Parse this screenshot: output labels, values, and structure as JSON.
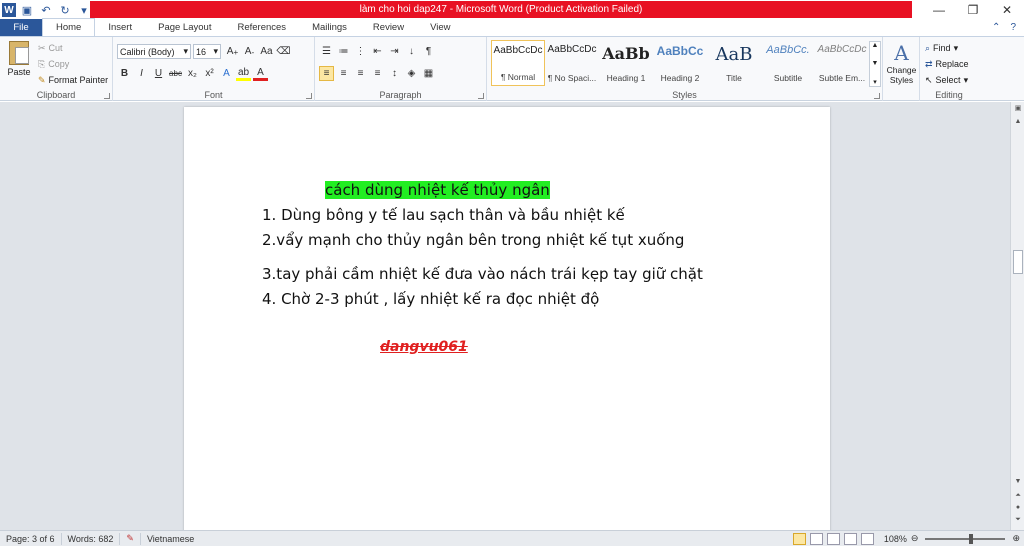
{
  "titlebar": {
    "title": "làm cho hoi dap247  -  Microsoft Word (Product Activation Failed)"
  },
  "tabs": [
    "File",
    "Home",
    "Insert",
    "Page Layout",
    "References",
    "Mailings",
    "Review",
    "View"
  ],
  "clipboard": {
    "paste": "Paste",
    "cut": "Cut",
    "copy": "Copy",
    "format_painter": "Format Painter",
    "label": "Clipboard"
  },
  "font": {
    "name": "Calibri (Body)",
    "size": "16",
    "label": "Font"
  },
  "paragraph": {
    "label": "Paragraph"
  },
  "styles": {
    "label": "Styles",
    "items": [
      {
        "sample": "AaBbCcDc",
        "name": "¶ Normal"
      },
      {
        "sample": "AaBbCcDc",
        "name": "¶ No Spaci..."
      },
      {
        "sample": "AaBb",
        "name": "Heading 1"
      },
      {
        "sample": "AaBbCc",
        "name": "Heading 2"
      },
      {
        "sample": "AaB",
        "name": "Title"
      },
      {
        "sample": "AaBbCc.",
        "name": "Subtitle"
      },
      {
        "sample": "AaBbCcDc",
        "name": "Subtle Em..."
      }
    ],
    "change_styles": "Change Styles"
  },
  "editing": {
    "find": "Find",
    "replace": "Replace",
    "select": "Select",
    "label": "Editing"
  },
  "document": {
    "heading": "cách dùng nhiệt kế thủy ngân",
    "lines": [
      "1. Dùng bông y tế lau sạch thân và bầu nhiệt kế",
      "2.vẩy mạnh cho thủy ngân bên trong nhiệt kế tụt xuống",
      "3.tay phải cầm nhiệt kế đưa vào nách trái kẹp tay giữ chặt",
      "4. Chờ 2-3 phút , lấy nhiệt kế ra đọc nhiệt độ"
    ],
    "signature": "dangvu061"
  },
  "status": {
    "page": "Page: 3 of 6",
    "words": "Words: 682",
    "language": "Vietnamese",
    "zoom": "108%"
  },
  "colors": {
    "highlight": "#22ee22",
    "title_bar": "#e81123",
    "file_tab": "#2b579a",
    "signature": "#e02020"
  }
}
